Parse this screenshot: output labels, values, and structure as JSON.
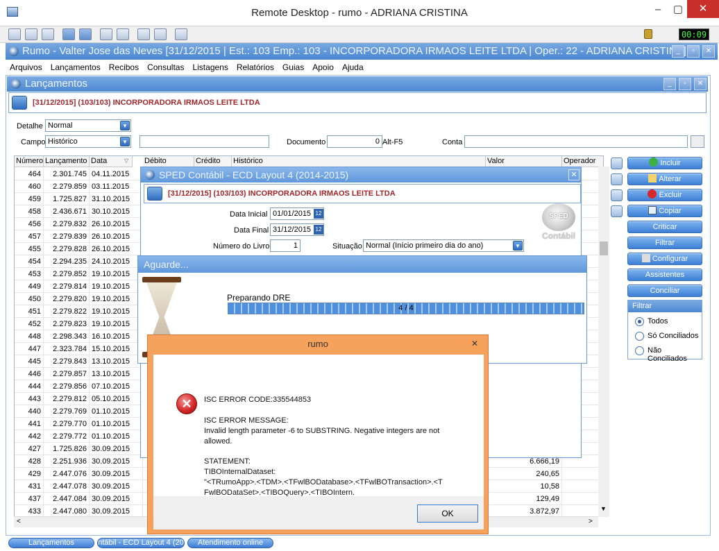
{
  "rd": {
    "title": "Remote Desktop - rumo - ADRIANA CRISTINA",
    "clock": "00:09"
  },
  "app": {
    "title": "Rumo - Valter Jose das Neves [31/12/2015 | Est.: 103 Emp.: 103 - INCORPORADORA IRMAOS LEITE LTDA | Oper.: 22 - ADRIANA CRISTINA]"
  },
  "menu": [
    "Arquivos",
    "Lançamentos",
    "Recibos",
    "Consultas",
    "Listagens",
    "Relatórios",
    "Guias",
    "Apoio",
    "Ajuda"
  ],
  "lanc": {
    "title": "Lançamentos",
    "banner": "[31/12/2015] (103/103) INCORPORADORA IRMAOS LEITE LTDA",
    "detalhe_label": "Detalhe",
    "detalhe_value": "Normal",
    "campo_label": "Campo",
    "campo_value": "Histórico",
    "documento_label": "Documento",
    "documento_value": "0",
    "altf5": "Alt-F5",
    "conta_label": "Conta"
  },
  "grid": {
    "headers": [
      "Número",
      "Lançamento",
      "Data",
      "Débito",
      "Crédito",
      "Histórico",
      "Valor",
      "Operador"
    ],
    "rows": [
      [
        "464",
        "2.301.745",
        "04.11.2015",
        ""
      ],
      [
        "460",
        "2.279.859",
        "03.11.2015",
        ""
      ],
      [
        "459",
        "1.725.827",
        "31.10.2015",
        ""
      ],
      [
        "458",
        "2.436.671",
        "30.10.2015",
        ""
      ],
      [
        "456",
        "2.279.832",
        "26.10.2015",
        ""
      ],
      [
        "457",
        "2.279.839",
        "26.10.2015",
        ""
      ],
      [
        "455",
        "2.279.828",
        "26.10.2015",
        ""
      ],
      [
        "454",
        "2.294.235",
        "24.10.2015",
        ""
      ],
      [
        "453",
        "2.279.852",
        "19.10.2015",
        ""
      ],
      [
        "449",
        "2.279.814",
        "19.10.2015",
        ""
      ],
      [
        "450",
        "2.279.820",
        "19.10.2015",
        ""
      ],
      [
        "451",
        "2.279.822",
        "19.10.2015",
        ""
      ],
      [
        "452",
        "2.279.823",
        "19.10.2015",
        ""
      ],
      [
        "448",
        "2.298.343",
        "16.10.2015",
        ""
      ],
      [
        "447",
        "2.323.784",
        "15.10.2015",
        ""
      ],
      [
        "445",
        "2.279.843",
        "13.10.2015",
        ""
      ],
      [
        "446",
        "2.279.857",
        "13.10.2015",
        ""
      ],
      [
        "444",
        "2.279.856",
        "07.10.2015",
        ""
      ],
      [
        "443",
        "2.279.812",
        "05.10.2015",
        ""
      ],
      [
        "440",
        "2.279.769",
        "01.10.2015",
        ""
      ],
      [
        "441",
        "2.279.770",
        "01.10.2015",
        ""
      ],
      [
        "442",
        "2.279.772",
        "01.10.2015",
        ""
      ],
      [
        "427",
        "1.725.826",
        "30.09.2015",
        ""
      ],
      [
        "428",
        "2.251.936",
        "30.09.2015",
        "6.666,19"
      ],
      [
        "429",
        "2.447.076",
        "30.09.2015",
        "240,65"
      ],
      [
        "431",
        "2.447.078",
        "30.09.2015",
        "10,58"
      ],
      [
        "437",
        "2.447.084",
        "30.09.2015",
        "129,49"
      ],
      [
        "433",
        "2.447.080",
        "30.09.2015",
        "3.872,97"
      ]
    ]
  },
  "side": {
    "buttons": [
      "Incluir",
      "Alterar",
      "Excluir",
      "Copiar",
      "Criticar",
      "Filtrar",
      "Configurar",
      "Assistentes",
      "Conciliar"
    ],
    "filtro_title": "Filtrar",
    "filtro_opts": [
      "Todos",
      "Só Conciliados",
      "Não Conciliados"
    ]
  },
  "sped": {
    "title": "SPED Contábil - ECD Layout 4 (2014-2015)",
    "banner": "[31/12/2015] (103/103) INCORPORADORA IRMAOS LEITE LTDA",
    "data_inicial_label": "Data Inicial",
    "data_inicial": "01/01/2015",
    "data_final_label": "Data Final",
    "data_final": "31/12/2015",
    "numero_livro_label": "Número do Livro",
    "numero_livro": "1",
    "situacao_label": "Situação",
    "situacao": "Normal (Início primeiro dia do ano)",
    "cal_icon": "12",
    "logo_top": "SPED",
    "logo_bottom": "Contábil"
  },
  "aguarde": {
    "title": "Aguarde...",
    "status": "Preparando DRE",
    "progress_text": "4 / 4",
    "progress": 1.0
  },
  "error": {
    "title": "rumo",
    "code": "ISC ERROR CODE:335544853",
    "msg_label": "ISC ERROR MESSAGE:",
    "msg_1": "Invalid length parameter -6 to SUBSTRING. Negative integers are not",
    "msg_2": "allowed.",
    "stmt_label": "STATEMENT:",
    "stmt_1": "TIBOInternalDataset:",
    "stmt_2": "\"<TRumoApp>.<TDM>.<TFwlBODatabase>.<TFwlBOTransaction>.<T",
    "stmt_3": "FwlBODataSet>.<TIBOQuery>.<TIBOIntern.",
    "ok": "OK"
  },
  "tasks": [
    "Lançamentos",
    "ntábil - ECD Layout 4 (20",
    "Atendimento online"
  ]
}
